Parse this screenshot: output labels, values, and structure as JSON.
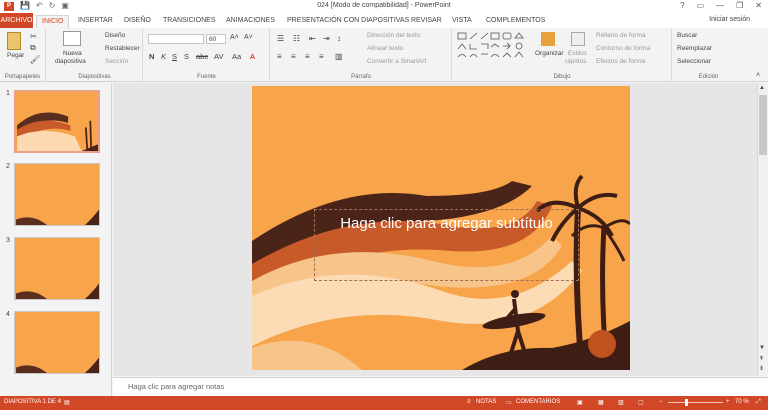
{
  "app": {
    "title": "024 [Modo de compatibilidad] - PowerPoint",
    "signin": "Iniciar sesión",
    "brand_color": "#d24726",
    "qat_icons": [
      "save-icon",
      "undo-icon",
      "redo-icon",
      "present-icon"
    ],
    "window_controls": [
      "?",
      "▭",
      "—",
      "❐",
      "✕"
    ]
  },
  "tabs": [
    {
      "label": "ARCHIVO"
    },
    {
      "label": "INICIO"
    },
    {
      "label": "INSERTAR"
    },
    {
      "label": "DISEÑO"
    },
    {
      "label": "TRANSICIONES"
    },
    {
      "label": "ANIMACIONES"
    },
    {
      "label": "PRESENTACIÓN CON DIAPOSITIVAS"
    },
    {
      "label": "REVISAR"
    },
    {
      "label": "VISTA"
    },
    {
      "label": "COMPLEMENTOS"
    }
  ],
  "ribbon": {
    "portapapeles": {
      "label": "Portapapeles",
      "paste": "Pegar"
    },
    "diapositivas": {
      "label": "Diapositivas",
      "new_slide": "Nueva",
      "new_slide2": "diapositiva",
      "layout": "Diseño",
      "reset": "Restablecer",
      "section": "Sección"
    },
    "fuente": {
      "label": "Fuente",
      "font_size": "60"
    },
    "parrafo": {
      "label": "Párrafo",
      "text_direction": "Dirección del texto",
      "align_text": "Alinear texto",
      "smartart": "Convertir a SmartArt"
    },
    "dibujo": {
      "label": "Dibujo",
      "arrange": "Organizar",
      "styles": "Estilos",
      "styles2": "rápidos",
      "fill": "Relleno de forma",
      "outline": "Contorno de forma",
      "effects": "Efectos de forma"
    },
    "edicion": {
      "label": "Edición",
      "find": "Buscar",
      "replace": "Reemplazar",
      "select": "Seleccionar"
    }
  },
  "thumbnails": [
    {
      "number": "1"
    },
    {
      "number": "2"
    },
    {
      "number": "3"
    },
    {
      "number": "4"
    }
  ],
  "slide": {
    "subtitle_placeholder": "Haga clic para agregar subtítulo",
    "bg_color": "#f7a44a"
  },
  "notes": {
    "placeholder": "Haga clic para agregar notas"
  },
  "status": {
    "slide_counter": "DIAPOSITIVA 1 DE 4",
    "notes": "NOTAS",
    "comments": "COMENTARIOS",
    "zoom": "70 %",
    "zoom_level_percent": 70
  }
}
